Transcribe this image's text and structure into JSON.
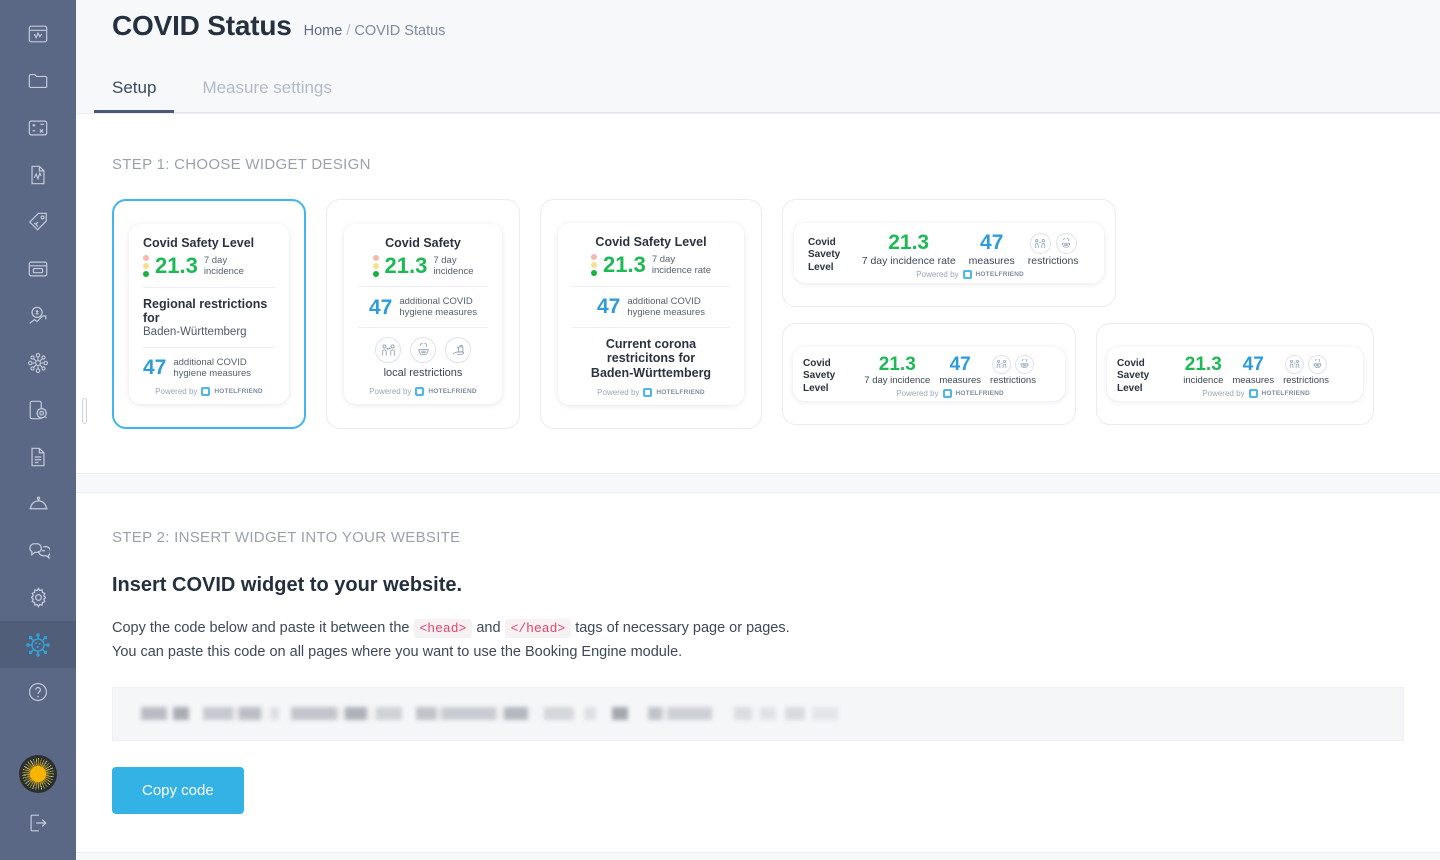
{
  "sidebar": {
    "items": [
      {
        "name": "dashboard",
        "icon": "dashboard-window-icon"
      },
      {
        "name": "folder",
        "icon": "folder-icon"
      },
      {
        "name": "calculator",
        "icon": "calculator-icon"
      },
      {
        "name": "reports",
        "icon": "report-chart-document-icon"
      },
      {
        "name": "pricing",
        "icon": "price-tag-icon"
      },
      {
        "name": "booking",
        "icon": "browser-card-icon"
      },
      {
        "name": "revenue",
        "icon": "dollar-growth-icon"
      },
      {
        "name": "channels",
        "icon": "network-nodes-icon"
      },
      {
        "name": "device-settings",
        "icon": "device-gear-icon"
      },
      {
        "name": "documents",
        "icon": "document-lines-icon"
      },
      {
        "name": "restaurant",
        "icon": "food-cloche-icon"
      },
      {
        "name": "messages",
        "icon": "chat-bubbles-icon"
      },
      {
        "name": "settings",
        "icon": "gear-icon"
      },
      {
        "name": "covid-status",
        "icon": "virus-icon",
        "active": true
      },
      {
        "name": "help",
        "icon": "question-circle-icon"
      }
    ],
    "brand_logo": "sun-burst-logo",
    "logout": "logout-arrow-icon",
    "collapse_handle": "sidebar-collapse-handle"
  },
  "header": {
    "title": "COVID Status",
    "breadcrumb": {
      "home": "Home",
      "separator": "/",
      "current": "COVID Status"
    }
  },
  "tabs": [
    {
      "label": "Setup",
      "active": true
    },
    {
      "label": "Measure settings",
      "active": false
    }
  ],
  "step1": {
    "label": "STEP 1: CHOOSE WIDGET DESIGN",
    "widgets": [
      {
        "id": "widget-vertical-regional",
        "selected": true,
        "title": "Covid Safety Level",
        "incidence_value": "21.3",
        "incidence_label_line1": "7 day",
        "incidence_label_line2": "incidence",
        "regional_title": "Regional restrictions for",
        "regional_sub": "Baden-Württemberg",
        "measures_value": "47",
        "measures_label_line1": "additional COVID",
        "measures_label_line2": "hygiene measures",
        "powered_by": "Powered by",
        "brand": "HOTELFRIEND"
      },
      {
        "id": "widget-vertical-icons",
        "selected": false,
        "title": "Covid Safety",
        "incidence_value": "21.3",
        "incidence_label_line1": "7 day",
        "incidence_label_line2": "incidence",
        "measures_value": "47",
        "measures_label_line1": "additional COVID",
        "measures_label_line2": "hygiene measures",
        "icons": [
          "social-distancing-icon",
          "face-mask-icon",
          "hand-sanitizer-icon"
        ],
        "restrictions_label": "local restrictions",
        "powered_by": "Powered by",
        "brand": "HOTELFRIEND"
      },
      {
        "id": "widget-vertical-corona",
        "selected": false,
        "title": "Covid Safety Level",
        "incidence_value": "21.3",
        "incidence_label_line1": "7 day",
        "incidence_label_line2": "incidence rate",
        "measures_value": "47",
        "measures_label_line1": "additional COVID",
        "measures_label_line2": "hygiene measures",
        "corona_title": "Current corona restricitons for",
        "corona_sub": "Baden-Württemberg",
        "powered_by": "Powered by",
        "brand": "HOTELFRIEND"
      },
      {
        "id": "widget-horizontal-large",
        "selected": false,
        "left_line1": "Covid",
        "left_line2": "Savety",
        "left_line3": "Level",
        "incidence_value": "21.3",
        "incidence_label": "7 day incidence rate",
        "measures_value": "47",
        "measures_label": "measures",
        "restrictions_label": "restrictions",
        "icons": [
          "social-distancing-icon",
          "face-mask-icon"
        ],
        "powered_by": "Powered by",
        "brand": "HOTELFRIEND"
      },
      {
        "id": "widget-horizontal-medium",
        "selected": false,
        "left_line1": "Covid",
        "left_line2": "Savety",
        "left_line3": "Level",
        "incidence_value": "21.3",
        "incidence_label": "7 day incidence",
        "measures_value": "47",
        "measures_label": "measures",
        "restrictions_label": "restrictions",
        "icons": [
          "social-distancing-icon",
          "face-mask-icon"
        ],
        "powered_by": "Powered by",
        "brand": "HOTELFRIEND"
      },
      {
        "id": "widget-horizontal-small",
        "selected": false,
        "left_line1": "Covid",
        "left_line2": "Savety",
        "left_line3": "Level",
        "incidence_value": "21.3",
        "incidence_label": "incidence",
        "measures_value": "47",
        "measures_label": "measures",
        "restrictions_label": "restrictions",
        "icons": [
          "social-distancing-icon",
          "face-mask-icon"
        ],
        "powered_by": "Powered by",
        "brand": "HOTELFRIEND"
      }
    ]
  },
  "step2": {
    "label": "STEP 2: INSERT WIDGET INTO YOUR WEBSITE",
    "heading": "Insert COVID widget to your website.",
    "para_part1": "Copy the code below and paste it between the",
    "tag_open": "<head>",
    "para_part2": "and",
    "tag_close": "</head>",
    "para_part3": "tags of necessary page or pages.",
    "para_line2": "You can paste this code on all pages where you want to use the Booking Engine module.",
    "code_value": "",
    "copy_button": "Copy code"
  },
  "colors": {
    "sidebar_bg": "#5a6785",
    "sidebar_active": "#515e7a",
    "accent_blue": "#33b2e5",
    "selected_border": "#3fb6ef",
    "value_green": "#1db954",
    "value_blue": "#2d9cdb",
    "tag_pink": "#e8436f",
    "page_bg": "#f7f8fa"
  }
}
